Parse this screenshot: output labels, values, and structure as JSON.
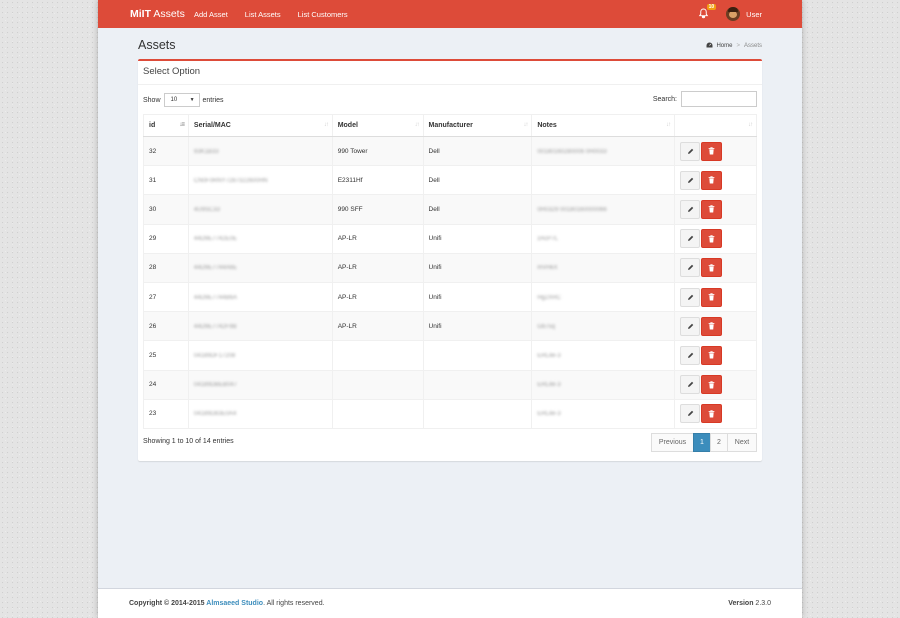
{
  "navbar": {
    "logo_bold": "MiIT",
    "logo_rest": " Assets",
    "links": [
      "Add Asset",
      "List Assets",
      "List Customers"
    ],
    "notification_count": "10",
    "user_name": "User",
    "color": "#dd4b39"
  },
  "page": {
    "title": "Assets",
    "breadcrumb_home": "Home",
    "breadcrumb_current": "Assets"
  },
  "box": {
    "title": "Select Option",
    "show_label": "Show",
    "entries_value": "10",
    "entries_label": "entries",
    "search_label": "Search:",
    "columns": [
      "id",
      "Serial/MAC",
      "Model",
      "Manufacturer",
      "Notes",
      ""
    ],
    "rows": [
      {
        "id": "32",
        "serial": "93K1B33",
        "model": "990 Tower",
        "manufacturer": "Dell",
        "notes": "00180160280006 0H0033"
      },
      {
        "id": "31",
        "serial": "CN0F0RNY7287322600HN",
        "model": "E2311Hf",
        "manufacturer": "Dell",
        "notes": ""
      },
      {
        "id": "30",
        "serial": "4U9SC33",
        "model": "990 SFF",
        "manufacturer": "Dell",
        "notes": "0H0329 00180160000066"
      },
      {
        "id": "29",
        "serial": "44D9E7742E0E",
        "model": "AP-LR",
        "manufacturer": "Unifi",
        "notes": "zAcP7L"
      },
      {
        "id": "28",
        "serial": "44D9E7744A6E",
        "model": "AP-LR",
        "manufacturer": "Unifi",
        "notes": "mVHkX"
      },
      {
        "id": "27",
        "serial": "44D9E7744B6A",
        "model": "AP-LR",
        "manufacturer": "Unifi",
        "notes": "Hg2XRC"
      },
      {
        "id": "26",
        "serial": "44D9E7742F9B",
        "model": "AP-LR",
        "manufacturer": "Unifi",
        "notes": "Gb7sq"
      },
      {
        "id": "25",
        "serial": "04189DF17208",
        "model": "",
        "manufacturer": "",
        "notes": "ERLite-3"
      },
      {
        "id": "24",
        "serial": "04189DBEB047",
        "model": "",
        "manufacturer": "",
        "notes": "ERLite-3"
      },
      {
        "id": "23",
        "serial": "04189D83E0A4",
        "model": "",
        "manufacturer": "",
        "notes": "ERLite-3"
      }
    ],
    "showing_text": "Showing 1 to 10 of 14 entries",
    "pagination": [
      "Previous",
      "1",
      "2",
      "Next"
    ],
    "active_page": "1"
  },
  "footer": {
    "copyright": "Copyright © 2014-2015 ",
    "studio": "Almsaeed Studio",
    "rights": ". All rights reserved.",
    "version_label": "Version",
    "version_value": " 2.3.0"
  },
  "icons": {
    "bell": "bell-icon",
    "home": "dashboard-icon",
    "edit": "pencil-icon",
    "delete": "trash-icon"
  }
}
